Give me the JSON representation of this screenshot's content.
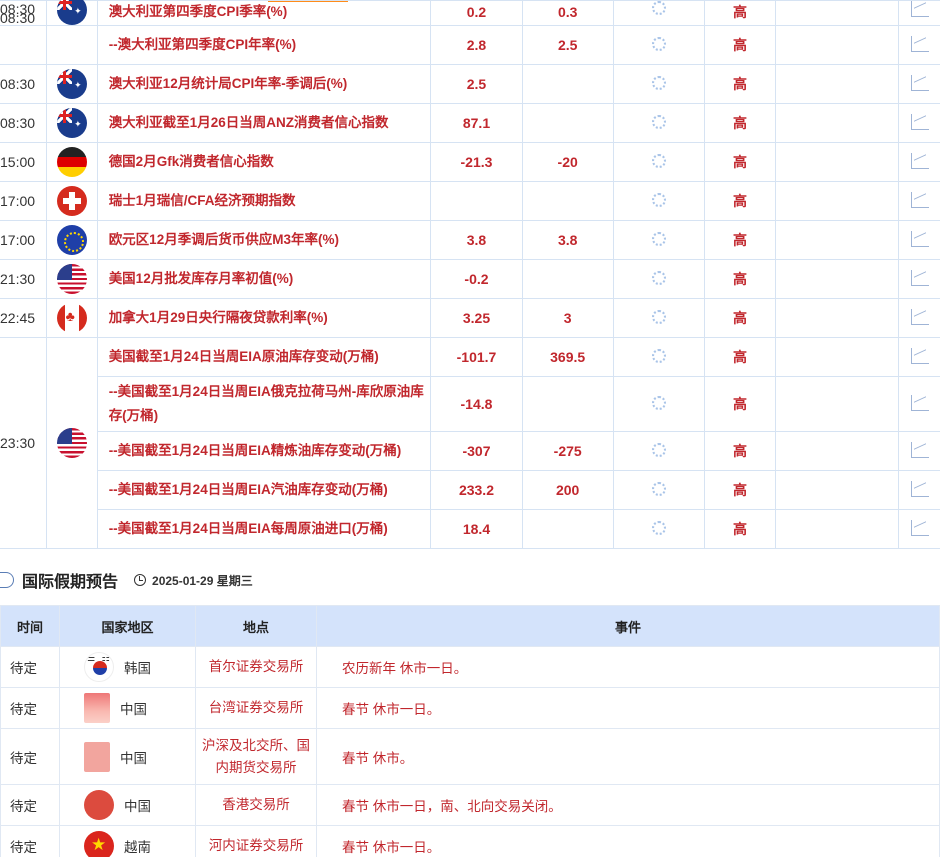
{
  "econ_rows": [
    {
      "time": "08:30",
      "flag": "australia-flag",
      "name": "澳大利亚第四季度CPI季率(%)",
      "prev": "0.2",
      "forecast": "0.3",
      "importance": "高"
    },
    {
      "time": "",
      "flag": "",
      "name": "--澳大利亚第四季度CPI年率(%)",
      "prev": "2.8",
      "forecast": "2.5",
      "importance": "高"
    },
    {
      "time": "08:30",
      "flag": "australia-flag",
      "name": "澳大利亚12月统计局CPI年率-季调后(%)",
      "prev": "2.5",
      "forecast": "",
      "importance": "高"
    },
    {
      "time": "08:30",
      "flag": "australia-flag",
      "name": "澳大利亚截至1月26日当周ANZ消费者信心指数",
      "prev": "87.1",
      "forecast": "",
      "importance": "高"
    },
    {
      "time": "15:00",
      "flag": "germany-flag",
      "name": "德国2月Gfk消费者信心指数",
      "prev": "-21.3",
      "forecast": "-20",
      "importance": "高"
    },
    {
      "time": "17:00",
      "flag": "switzerland-flag",
      "name": "瑞士1月瑞信/CFA经济预期指数",
      "prev": "",
      "forecast": "",
      "importance": "高"
    },
    {
      "time": "17:00",
      "flag": "eurozone-flag",
      "name": "欧元区12月季调后货币供应M3年率(%)",
      "prev": "3.8",
      "forecast": "3.8",
      "importance": "高"
    },
    {
      "time": "21:30",
      "flag": "usa-flag",
      "name": "美国12月批发库存月率初值(%)",
      "prev": "-0.2",
      "forecast": "",
      "importance": "高"
    },
    {
      "time": "22:45",
      "flag": "canada-flag",
      "name": "加拿大1月29日央行隔夜贷款利率(%)",
      "prev": "3.25",
      "forecast": "3",
      "importance": "高"
    }
  ],
  "eia_group": {
    "time": "23:30",
    "flag": "usa-flag",
    "rows": [
      {
        "name": "美国截至1月24日当周EIA原油库存变动(万桶)",
        "prev": "-101.7",
        "forecast": "369.5",
        "importance": "高"
      },
      {
        "name": "--美国截至1月24日当周EIA俄克拉荷马州-库欣原油库存(万桶)",
        "prev": "-14.8",
        "forecast": "",
        "importance": "高"
      },
      {
        "name": "--美国截至1月24日当周EIA精炼油库存变动(万桶)",
        "prev": "-307",
        "forecast": "-275",
        "importance": "高"
      },
      {
        "name": "--美国截至1月24日当周EIA汽油库存变动(万桶)",
        "prev": "233.2",
        "forecast": "200",
        "importance": "高"
      },
      {
        "name": "--美国截至1月24日当周EIA每周原油进口(万桶)",
        "prev": "18.4",
        "forecast": "",
        "importance": "高"
      }
    ]
  },
  "holiday_section": {
    "title": "国际假期预告",
    "date": "2025-01-29 星期三",
    "headers": {
      "time": "时间",
      "country": "国家地区",
      "place": "地点",
      "event": "事件"
    },
    "rows": [
      {
        "time": "待定",
        "country": "韩国",
        "flag": "south-korea-flag",
        "place": "首尔证券交易所",
        "event": "农历新年 休市一日。"
      },
      {
        "time": "待定",
        "country": "中国",
        "flag": "blurred-flag",
        "place": "台湾证券交易所",
        "event": "春节 休市一日。"
      },
      {
        "time": "待定",
        "country": "中国",
        "flag": "china-flag",
        "place": "沪深及北交所、国内期货交易所",
        "event": "春节 休市。"
      },
      {
        "time": "待定",
        "country": "中国",
        "flag": "hong-kong-flag",
        "place": "香港交易所",
        "event": "春节 休市一日，南、北向交易关闭。"
      },
      {
        "time": "待定",
        "country": "越南",
        "flag": "vietnam-flag",
        "place": "河内证券交易所",
        "event": "春节 休市一日。"
      }
    ]
  }
}
